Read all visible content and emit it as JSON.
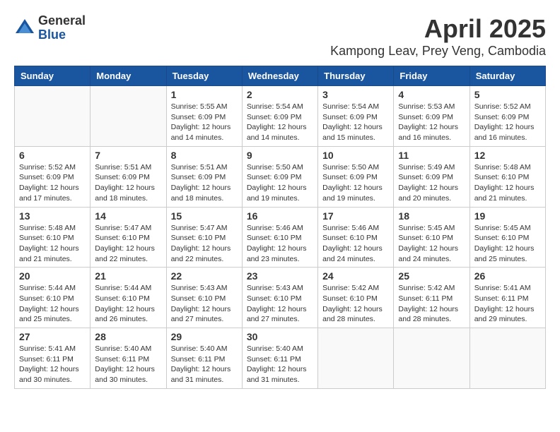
{
  "header": {
    "logo": {
      "general": "General",
      "blue": "Blue"
    },
    "title": "April 2025",
    "subtitle": "Kampong Leav, Prey Veng, Cambodia"
  },
  "calendar": {
    "days_of_week": [
      "Sunday",
      "Monday",
      "Tuesday",
      "Wednesday",
      "Thursday",
      "Friday",
      "Saturday"
    ],
    "weeks": [
      [
        {
          "day": "",
          "info": ""
        },
        {
          "day": "",
          "info": ""
        },
        {
          "day": "1",
          "info": "Sunrise: 5:55 AM\nSunset: 6:09 PM\nDaylight: 12 hours and 14 minutes."
        },
        {
          "day": "2",
          "info": "Sunrise: 5:54 AM\nSunset: 6:09 PM\nDaylight: 12 hours and 14 minutes."
        },
        {
          "day": "3",
          "info": "Sunrise: 5:54 AM\nSunset: 6:09 PM\nDaylight: 12 hours and 15 minutes."
        },
        {
          "day": "4",
          "info": "Sunrise: 5:53 AM\nSunset: 6:09 PM\nDaylight: 12 hours and 16 minutes."
        },
        {
          "day": "5",
          "info": "Sunrise: 5:52 AM\nSunset: 6:09 PM\nDaylight: 12 hours and 16 minutes."
        }
      ],
      [
        {
          "day": "6",
          "info": "Sunrise: 5:52 AM\nSunset: 6:09 PM\nDaylight: 12 hours and 17 minutes."
        },
        {
          "day": "7",
          "info": "Sunrise: 5:51 AM\nSunset: 6:09 PM\nDaylight: 12 hours and 18 minutes."
        },
        {
          "day": "8",
          "info": "Sunrise: 5:51 AM\nSunset: 6:09 PM\nDaylight: 12 hours and 18 minutes."
        },
        {
          "day": "9",
          "info": "Sunrise: 5:50 AM\nSunset: 6:09 PM\nDaylight: 12 hours and 19 minutes."
        },
        {
          "day": "10",
          "info": "Sunrise: 5:50 AM\nSunset: 6:09 PM\nDaylight: 12 hours and 19 minutes."
        },
        {
          "day": "11",
          "info": "Sunrise: 5:49 AM\nSunset: 6:09 PM\nDaylight: 12 hours and 20 minutes."
        },
        {
          "day": "12",
          "info": "Sunrise: 5:48 AM\nSunset: 6:10 PM\nDaylight: 12 hours and 21 minutes."
        }
      ],
      [
        {
          "day": "13",
          "info": "Sunrise: 5:48 AM\nSunset: 6:10 PM\nDaylight: 12 hours and 21 minutes."
        },
        {
          "day": "14",
          "info": "Sunrise: 5:47 AM\nSunset: 6:10 PM\nDaylight: 12 hours and 22 minutes."
        },
        {
          "day": "15",
          "info": "Sunrise: 5:47 AM\nSunset: 6:10 PM\nDaylight: 12 hours and 22 minutes."
        },
        {
          "day": "16",
          "info": "Sunrise: 5:46 AM\nSunset: 6:10 PM\nDaylight: 12 hours and 23 minutes."
        },
        {
          "day": "17",
          "info": "Sunrise: 5:46 AM\nSunset: 6:10 PM\nDaylight: 12 hours and 24 minutes."
        },
        {
          "day": "18",
          "info": "Sunrise: 5:45 AM\nSunset: 6:10 PM\nDaylight: 12 hours and 24 minutes."
        },
        {
          "day": "19",
          "info": "Sunrise: 5:45 AM\nSunset: 6:10 PM\nDaylight: 12 hours and 25 minutes."
        }
      ],
      [
        {
          "day": "20",
          "info": "Sunrise: 5:44 AM\nSunset: 6:10 PM\nDaylight: 12 hours and 25 minutes."
        },
        {
          "day": "21",
          "info": "Sunrise: 5:44 AM\nSunset: 6:10 PM\nDaylight: 12 hours and 26 minutes."
        },
        {
          "day": "22",
          "info": "Sunrise: 5:43 AM\nSunset: 6:10 PM\nDaylight: 12 hours and 27 minutes."
        },
        {
          "day": "23",
          "info": "Sunrise: 5:43 AM\nSunset: 6:10 PM\nDaylight: 12 hours and 27 minutes."
        },
        {
          "day": "24",
          "info": "Sunrise: 5:42 AM\nSunset: 6:10 PM\nDaylight: 12 hours and 28 minutes."
        },
        {
          "day": "25",
          "info": "Sunrise: 5:42 AM\nSunset: 6:11 PM\nDaylight: 12 hours and 28 minutes."
        },
        {
          "day": "26",
          "info": "Sunrise: 5:41 AM\nSunset: 6:11 PM\nDaylight: 12 hours and 29 minutes."
        }
      ],
      [
        {
          "day": "27",
          "info": "Sunrise: 5:41 AM\nSunset: 6:11 PM\nDaylight: 12 hours and 30 minutes."
        },
        {
          "day": "28",
          "info": "Sunrise: 5:40 AM\nSunset: 6:11 PM\nDaylight: 12 hours and 30 minutes."
        },
        {
          "day": "29",
          "info": "Sunrise: 5:40 AM\nSunset: 6:11 PM\nDaylight: 12 hours and 31 minutes."
        },
        {
          "day": "30",
          "info": "Sunrise: 5:40 AM\nSunset: 6:11 PM\nDaylight: 12 hours and 31 minutes."
        },
        {
          "day": "",
          "info": ""
        },
        {
          "day": "",
          "info": ""
        },
        {
          "day": "",
          "info": ""
        }
      ]
    ]
  }
}
